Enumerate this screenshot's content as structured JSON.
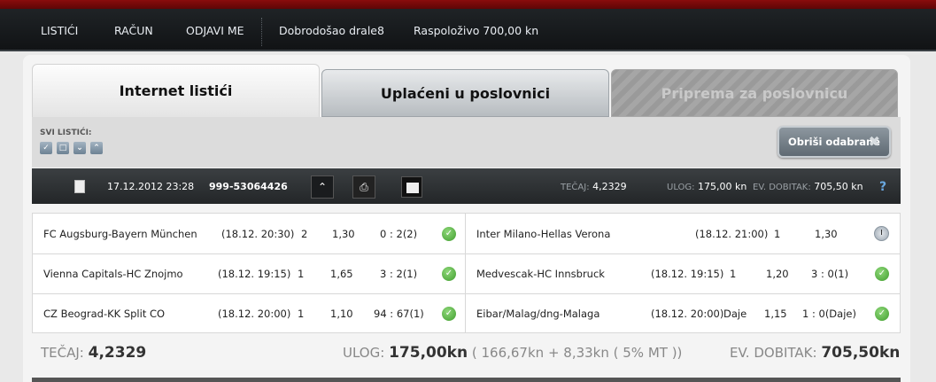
{
  "nav": {
    "items": [
      "LISTIĆI",
      "RAČUN",
      "ODJAVI ME"
    ],
    "welcome": "Dobrodošao drale8",
    "available": "Raspoloživo 700,00 kn"
  },
  "tabs": [
    "Internet listići",
    "Uplaćeni u poslovnici",
    "Priprema za poslovnicu"
  ],
  "toolbar": {
    "svi_label": "SVI LISTIĆI:",
    "delete_label": "Obriši odabrane"
  },
  "ticket": {
    "date": "17.12.2012 23:28",
    "id": "999-53064426",
    "tecaj_label": "TEČAJ:",
    "tecaj": "4,2329",
    "ulog_label": "ULOG:",
    "ulog": "175,00 kn",
    "dobitak_label": "EV. DOBITAK:",
    "dobitak": "705,50 kn",
    "help": "?"
  },
  "matches_left": [
    {
      "teams": "FC Augsburg-Bayern München",
      "time": "(18.12. 20:30)",
      "tip": "2",
      "odd": "1,30",
      "result": "0 : 2(2)",
      "status": "ok"
    },
    {
      "teams": "Vienna Capitals-HC Znojmo",
      "time": "(18.12. 19:15)",
      "tip": "1",
      "odd": "1,65",
      "result": "3 : 2(1)",
      "status": "ok"
    },
    {
      "teams": "CZ Beograd-KK Split CO",
      "time": "(18.12. 20:00)",
      "tip": "1",
      "odd": "1,10",
      "result": "94 : 67(1)",
      "status": "ok"
    }
  ],
  "matches_right": [
    {
      "teams": "Inter Milano-Hellas Verona",
      "time": "(18.12. 21:00)",
      "tip": "1",
      "odd": "1,30",
      "result": "",
      "status": "pending"
    },
    {
      "teams": "Medvescak-HC Innsbruck",
      "time": "(18.12. 19:15)",
      "tip": "1",
      "odd": "1,20",
      "result": "3 : 0(1)",
      "status": "ok"
    },
    {
      "teams": "Eibar/Malag/dng-Malaga",
      "time": "(18.12. 20:00)",
      "tip": "Daje",
      "odd": "1,15",
      "result": "1 : 0(Daje)",
      "status": "ok"
    }
  ],
  "summary": {
    "tecaj_label": "TEČAJ:",
    "tecaj": "4,2329",
    "ulog_label": "ULOG:",
    "ulog": "175,00kn",
    "ulog_detail": "( 166,67kn + 8,33kn ( 5% MT ))",
    "dobitak_label": "EV. DOBITAK:",
    "dobitak": "705,50kn"
  },
  "colors": {
    "accent_red": "#8a0c0c",
    "ok_green": "#3f9d2d",
    "dark_bar": "#2b2f32"
  }
}
